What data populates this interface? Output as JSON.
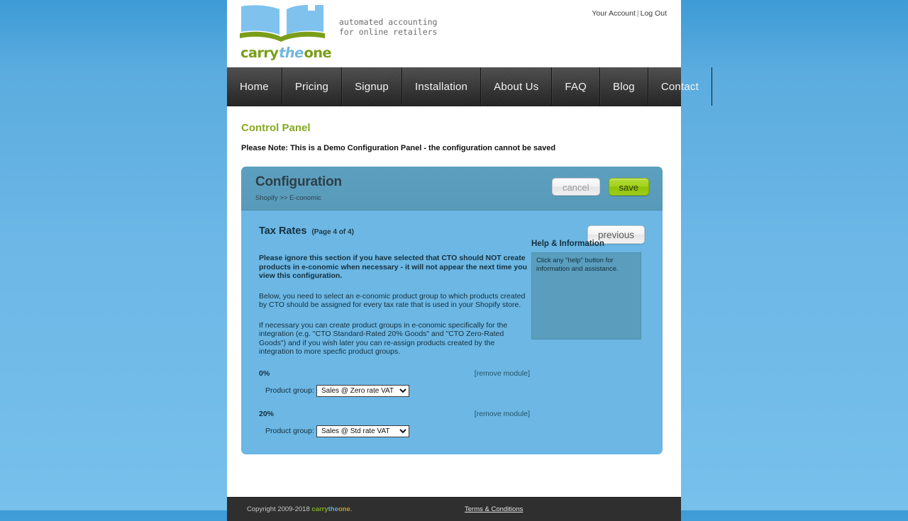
{
  "header": {
    "logo_parts": {
      "carry": "carry",
      "the": "the",
      "one": "one"
    },
    "tagline": "automated accounting\nfor online retailers",
    "account_link": "Your Account",
    "separator": "|",
    "logout_link": "Log Out"
  },
  "nav": {
    "items": [
      {
        "label": "Home"
      },
      {
        "label": "Pricing"
      },
      {
        "label": "Signup"
      },
      {
        "label": "Installation"
      },
      {
        "label": "About Us"
      },
      {
        "label": "FAQ"
      },
      {
        "label": "Blog"
      },
      {
        "label": "Contact"
      }
    ]
  },
  "main": {
    "page_title": "Control Panel",
    "demo_note": "Please Note: This is a Demo Configuration Panel - the configuration cannot be saved"
  },
  "config": {
    "title": "Configuration",
    "breadcrumb": "Shopify >> E-conomic",
    "cancel_label": "cancel",
    "save_label": "save",
    "previous_label": "previous",
    "section_title": "Tax Rates",
    "page_count": "(Page 4 of 4)",
    "warning_paragraph": "Please ignore this section if you have selected that CTO should NOT create products in e-conomic when necessary - it will not appear the next time you view this configuration.",
    "paragraph_1": "Below, you need to select an e-conomic product group to which products created by CTO should be assigned for every tax rate that is used in your Shopify store.",
    "paragraph_2": "If necessary you can create product groups in e-conomic specifically for the integration (e.g. \"CTO Standard-Rated 20% Goods\" and \"CTO Zero-Rated Goods\") and if you wish later you can re-assign products created by the integration to more specfic product groups.",
    "rates": [
      {
        "rate_label": "0%",
        "remove_label": "[remove module]",
        "group_label": "Product group:",
        "selected_group": "Sales @ Zero rate VAT"
      },
      {
        "rate_label": "20%",
        "remove_label": "[remove module]",
        "group_label": "Product group:",
        "selected_group": "Sales @ Std rate VAT"
      }
    ],
    "help_title": "Help & Information",
    "help_text": "Click any \"help\" button for information and assistance."
  },
  "footer": {
    "copyright_prefix": "Copyright 2009-2018 ",
    "logo_carry": "carry",
    "logo_the": "the",
    "logo_one": "one",
    "copyright_suffix": ".",
    "terms_label": "Terms & Conditions"
  },
  "colors": {
    "brand_green": "#7a9e19",
    "brand_blue": "#6fb7e0",
    "panel_blue": "#6cb7e4",
    "panel_head_blue": "#589ab9",
    "save_green": "#9ecd1a",
    "page_bg": "#6cb7e6"
  }
}
